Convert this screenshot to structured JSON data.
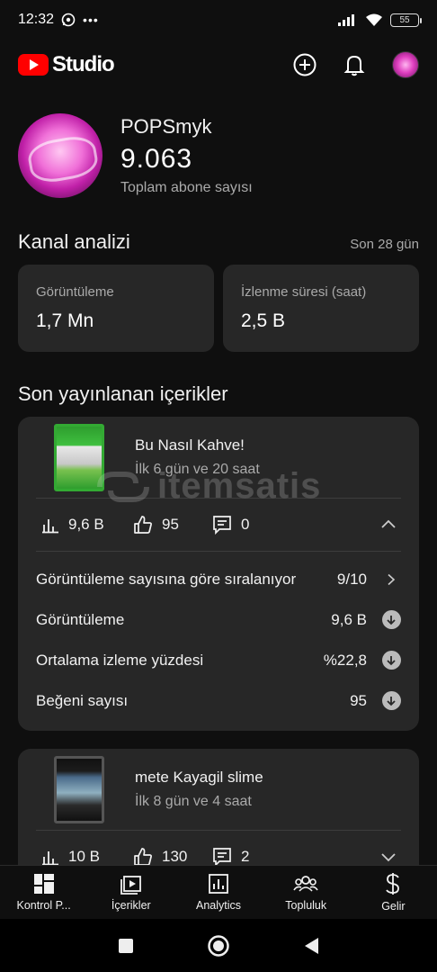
{
  "status_bar": {
    "time": "12:32",
    "battery": "55"
  },
  "app": {
    "wordmark": "Studio"
  },
  "channel": {
    "name": "POPSmyk",
    "subscribers": "9.063",
    "subscribers_label": "Toplam abone sayısı"
  },
  "analytics": {
    "title": "Kanal analizi",
    "period": "Son 28 gün",
    "metrics": [
      {
        "label": "Görüntüleme",
        "value": "1,7 Mn"
      },
      {
        "label": "İzlenme süresi (saat)",
        "value": "2,5 B"
      }
    ]
  },
  "recent": {
    "title": "Son yayınlanan içerikler",
    "videos": [
      {
        "title": "Bu Nasıl Kahve!",
        "subtitle": "İlk 6 gün ve 20 saat",
        "views": "9,6 B",
        "likes": "95",
        "comments": "0",
        "details": [
          {
            "label": "Görüntüleme sayısına göre sıralanıyor",
            "value": "9/10"
          },
          {
            "label": "Görüntüleme",
            "value": "9,6 B"
          },
          {
            "label": "Ortalama izleme yüzdesi",
            "value": "%22,8"
          },
          {
            "label": "Beğeni sayısı",
            "value": "95"
          }
        ]
      },
      {
        "title": "mete Kayagil slime",
        "subtitle": "İlk 8 gün ve 4 saat",
        "views": "10 B",
        "likes": "130",
        "comments": "2"
      }
    ]
  },
  "watermark": "itemsatis",
  "bottom_nav": [
    {
      "label": "Kontrol P...",
      "icon": "dashboard-icon"
    },
    {
      "label": "İçerikler",
      "icon": "content-icon"
    },
    {
      "label": "Analytics",
      "icon": "analytics-icon"
    },
    {
      "label": "Topluluk",
      "icon": "community-icon"
    },
    {
      "label": "Gelir",
      "icon": "earn-icon"
    }
  ]
}
